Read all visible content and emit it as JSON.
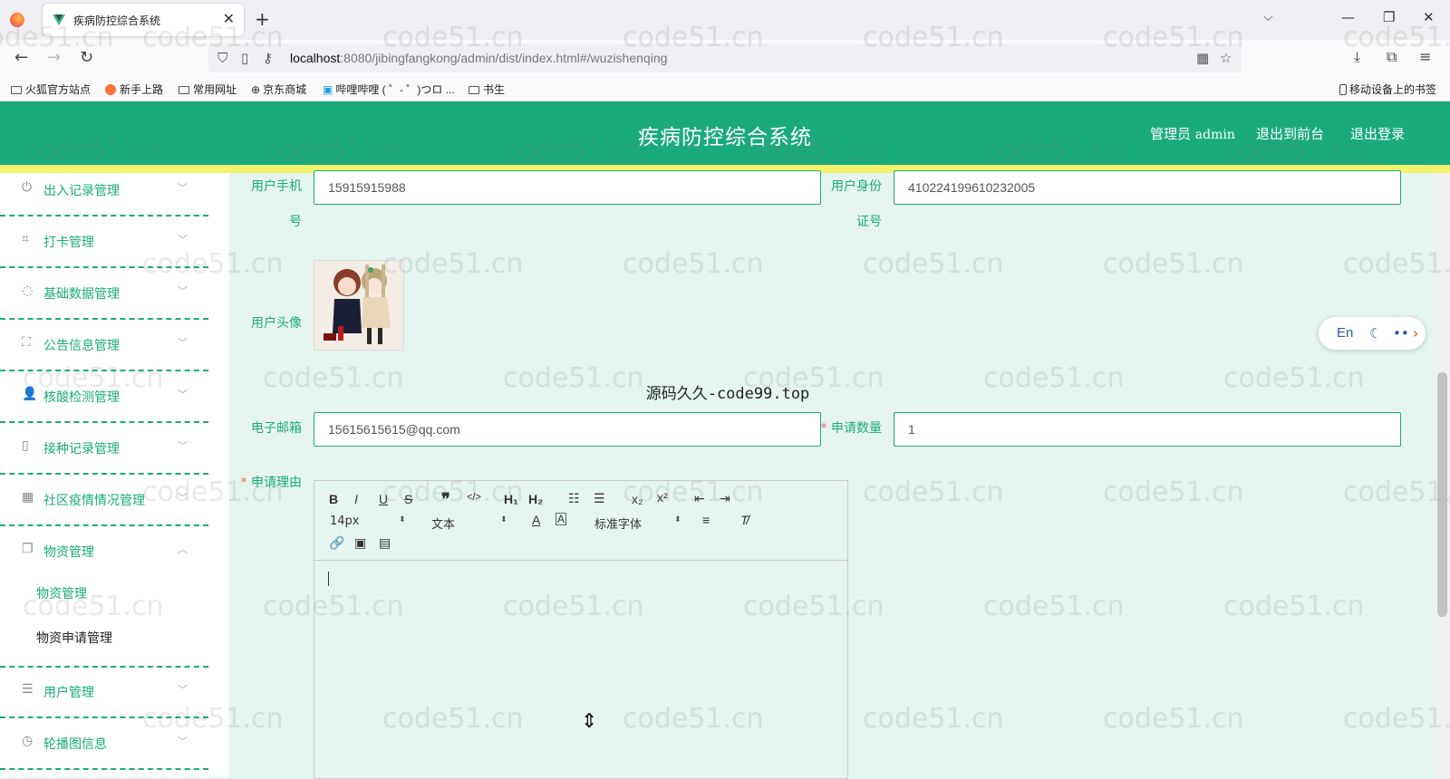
{
  "browser": {
    "tab_title": "疾病防控综合系统",
    "url_host": "localhost",
    "url_rest": ":8080/jibingfangkong/admin/dist/index.html#/wuzishenqing",
    "bookmarks": [
      "火狐官方站点",
      "新手上路",
      "常用网址",
      "京东商城",
      "哔哩哔哩 ( ゜- ゜)つロ ...",
      "书生"
    ],
    "mobile_bookmarks": "移动设备上的书签"
  },
  "header": {
    "title": "疾病防控综合系统",
    "user_prefix": "管理员",
    "user_name": "admin",
    "front_link": "退出到前台",
    "logout_link": "退出登录"
  },
  "sidebar": {
    "items": [
      {
        "label": "出入记录管理",
        "icon": "power-icon"
      },
      {
        "label": "打卡管理",
        "icon": "crop-icon"
      },
      {
        "label": "基础数据管理",
        "icon": "compass-icon"
      },
      {
        "label": "公告信息管理",
        "icon": "fullscreen-icon"
      },
      {
        "label": "核酸检测管理",
        "icon": "user-icon"
      },
      {
        "label": "接种记录管理",
        "icon": "mobile-icon"
      },
      {
        "label": "社区疫情情况管理",
        "icon": "grid-icon"
      },
      {
        "label": "物资管理",
        "icon": "copy-icon"
      },
      {
        "label": "用户管理",
        "icon": "list-icon"
      },
      {
        "label": "轮播图信息",
        "icon": "clock-icon"
      }
    ],
    "sub_items": [
      "物资管理",
      "物资申请管理"
    ]
  },
  "form": {
    "phone_label_1": "用户手机",
    "phone_label_2": "号",
    "phone_value": "15915915988",
    "id_label_1": "用户身份",
    "id_label_2": "证号",
    "id_value": "410224199610232005",
    "avatar_label": "用户头像",
    "center_text": "源码久久-code99.top",
    "email_label": "电子邮箱",
    "email_value": "15615615615@qq.com",
    "qty_label": "申请数量",
    "qty_value": "1",
    "reason_label": "申请理由"
  },
  "editor": {
    "font_size": "14px",
    "text_type": "文本",
    "font_family": "标准字体"
  },
  "float_tool": {
    "lang": "En"
  },
  "watermark": "code51.cn"
}
